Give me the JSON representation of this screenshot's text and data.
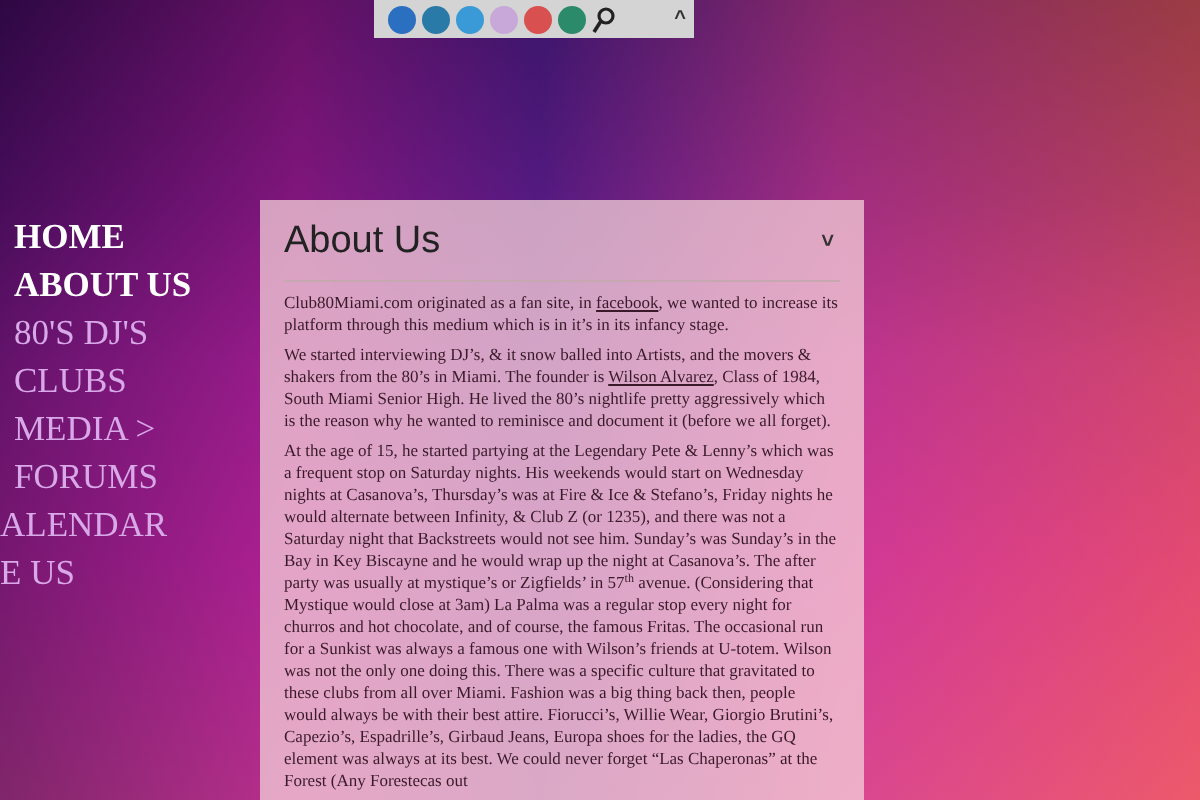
{
  "toolbar": {
    "collapse": "^"
  },
  "nav": [
    {
      "label": "HOME",
      "active": true
    },
    {
      "label": "ABOUT US",
      "active": true
    },
    {
      "label": "80'S DJ'S",
      "active": false
    },
    {
      "label": "CLUBS",
      "active": false
    },
    {
      "label": "MEDIA >",
      "active": false
    },
    {
      "label": "FORUMS",
      "active": false
    },
    {
      "label": "ALENDAR",
      "active": false
    },
    {
      "label": "E US",
      "active": false
    }
  ],
  "panel": {
    "title": "About Us",
    "toggle": "˅",
    "paragraphs": [
      [
        {
          "kind": "text",
          "text": "Club80Miami.com originated as a fan site, in "
        },
        {
          "kind": "link",
          "text": "facebook"
        },
        {
          "kind": "text",
          "text": ", we wanted to increase its platform through this medium which is in it’s in its infancy stage."
        }
      ],
      [
        {
          "kind": "text",
          "text": "We started interviewing DJ’s, & it snow balled into Artists, and the movers & shakers from the 80’s in Miami. The founder is "
        },
        {
          "kind": "link",
          "text": "Wilson Alvarez"
        },
        {
          "kind": "text",
          "text": ", Class of 1984, South Miami Senior High.  He lived the 80’s nightlife pretty aggressively which is the reason why he wanted to reminisce and document it (before we all forget)."
        }
      ],
      [
        {
          "kind": "text",
          "text": "At the age of 15, he started partying at the Legendary Pete & Lenny’s which was a frequent stop on Saturday nights.  His weekends would start on Wednesday nights at Casanova’s, Thursday’s was at Fire & Ice & Stefano’s, Friday nights he would alternate between Infinity, & Club Z (or 1235), and there was not a Saturday night that Backstreets would not see him. Sunday’s was Sunday’s in the Bay in Key Biscayne and he would wrap up the night at Casanova’s. The after party was usually at mystique’s or Zigfields’ in 57$^{th}$ avenue. (Considering that Mystique would close at 3am) La Palma was a regular stop every night for churros and hot chocolate, and of course, the famous Fritas. The occasional run for a Sunkist was always a famous one with Wilson’s friends at U-totem. Wilson was not the only one doing this. There was a specific culture that gravitated to these clubs from all over Miami. Fashion was a big thing back then, people would always be with their best attire. Fiorucci’s, Willie Wear, Giorgio Brutini’s, Capezio’s, Espadrille’s, Girbaud Jeans, Europa shoes for the ladies, the GQ element was always at its best.  We could never forget “Las Chaperonas” at the Forest (Any Forestecas out"
        }
      ]
    ]
  }
}
